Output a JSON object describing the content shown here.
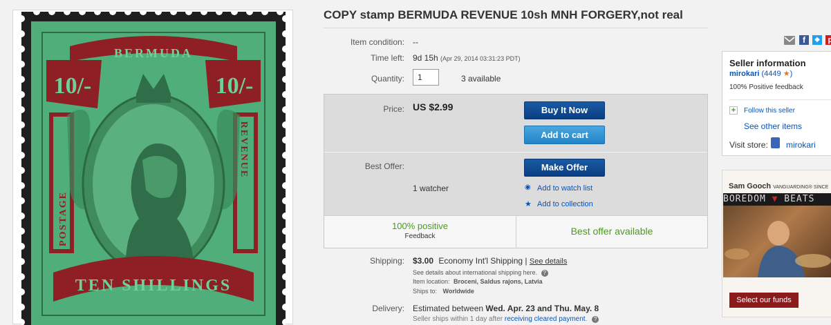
{
  "title": "COPY stamp BERMUDA REVENUE 10sh MNH FORGERY,not real",
  "stamp": {
    "top_text": "BERMUDA",
    "value_left": "10/-",
    "value_right": "10/-",
    "left_side": "POSTAGE",
    "right_side": "REVENUE",
    "bottom_text": "TEN SHILLINGS"
  },
  "details": {
    "condition_label": "Item condition:",
    "condition_value": "--",
    "time_label": "Time left:",
    "time_value": "9d 15h",
    "time_end": "(Apr 29, 2014   03:31:23 PDT)",
    "quantity_label": "Quantity:",
    "quantity_value": "1",
    "available": "3 available"
  },
  "price": {
    "label": "Price:",
    "value": "US $2.99",
    "buy_now": "Buy It Now",
    "add_to_cart": "Add to cart"
  },
  "offer": {
    "label": "Best Offer:",
    "make_offer": "Make Offer",
    "watchers": "1 watcher",
    "watch_link": "Add to watch list",
    "collection_link": "Add to collection"
  },
  "feedback": {
    "positive": "100% positive",
    "feedback_label": "Feedback",
    "best_offer": "Best offer available"
  },
  "shipping": {
    "label": "Shipping:",
    "cost": "$3.00",
    "method": "Economy Int'l Shipping",
    "separator": "|",
    "see_details": "See details",
    "intl_note": "See details about international shipping here.",
    "location_label": "Item location:",
    "location_value": "Broceni, Saldus rajons, Latvia",
    "ships_to_label": "Ships to:",
    "ships_to_value": "Worldwide"
  },
  "delivery": {
    "label": "Delivery:",
    "prefix": "Estimated between",
    "dates": "Wed. Apr. 23 and Thu. May. 8",
    "note_prefix": "Seller ships within 1 day after",
    "note_link": "receiving cleared payment",
    "note_suffix": "."
  },
  "seller": {
    "heading": "Seller information",
    "name": "mirokari",
    "score": "(4449",
    "score_close": ")",
    "positive": "100% Positive feedback",
    "follow": "Follow this seller",
    "other_items": "See other items",
    "store_label": "Visit store:",
    "store_name": "mirokari"
  },
  "ad": {
    "brand": "Sam Gooch",
    "tagline": "VANGUARDING® SINCE",
    "banner_left": "BOREDOM",
    "banner_right": "BEATS",
    "cta": "Select our funds"
  },
  "colors": {
    "stamp_green": "#4fae7a",
    "stamp_red": "#8e1f24",
    "ebay_blue": "#0654ba",
    "positive_green": "#4a9a1a",
    "star_orange": "#e8731a",
    "ad_red": "#8b1a1a"
  }
}
